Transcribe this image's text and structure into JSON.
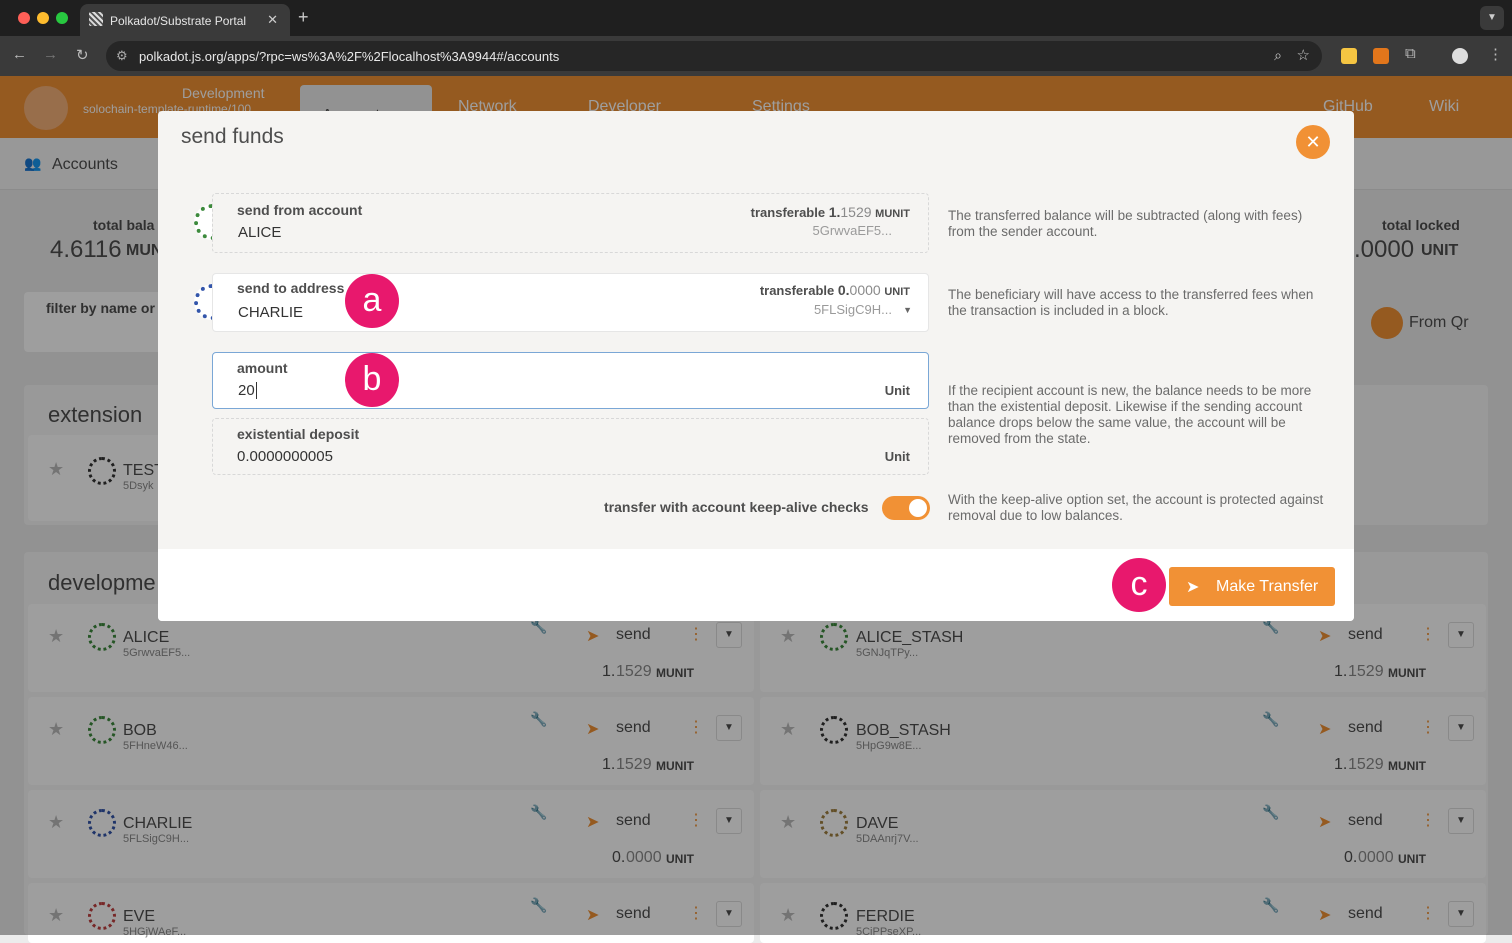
{
  "browser": {
    "tab_title": "Polkadot/Substrate Portal",
    "url": "polkadot.js.org/apps/?rpc=ws%3A%2F%2Flocalhost%3A9944#/accounts"
  },
  "app_header": {
    "chain": "Development",
    "runtime": "solochain-template-runtime/100",
    "nav": [
      "Accounts",
      "Network",
      "Developer",
      "Settings"
    ],
    "links": [
      "GitHub",
      "Wiki"
    ]
  },
  "subnav": {
    "accounts_label": "Accounts"
  },
  "summary": {
    "total_balance_label": "total bala",
    "total_balance_value": "4.6116",
    "total_balance_unit": "MUN",
    "total_locked_label": "total locked",
    "total_locked_value": ".0000",
    "total_locked_unit": "UNIT"
  },
  "filter": {
    "placeholder": "filter by name or"
  },
  "from_qr": "From Qr",
  "sections": {
    "extension": "extension",
    "development": "developme"
  },
  "extension_account": {
    "name": "TEST",
    "addr": "5Dsyk"
  },
  "accounts": [
    {
      "name": "ALICE",
      "addr": "5GrwvaEF5...",
      "bal_int": "1.",
      "bal_dec": "1529",
      "unit": "MUNIT",
      "send": "send"
    },
    {
      "name": "ALICE_STASH",
      "addr": "5GNJqTPy...",
      "bal_int": "1.",
      "bal_dec": "1529",
      "unit": "MUNIT",
      "send": "send"
    },
    {
      "name": "BOB",
      "addr": "5FHneW46...",
      "bal_int": "1.",
      "bal_dec": "1529",
      "unit": "MUNIT",
      "send": "send"
    },
    {
      "name": "BOB_STASH",
      "addr": "5HpG9w8E...",
      "bal_int": "1.",
      "bal_dec": "1529",
      "unit": "MUNIT",
      "send": "send"
    },
    {
      "name": "CHARLIE",
      "addr": "5FLSigC9H...",
      "bal_int": "0.",
      "bal_dec": "0000",
      "unit": "UNIT",
      "send": "send"
    },
    {
      "name": "DAVE",
      "addr": "5DAAnrj7V...",
      "bal_int": "0.",
      "bal_dec": "0000",
      "unit": "UNIT",
      "send": "send"
    },
    {
      "name": "EVE",
      "addr": "5HGjWAeF...",
      "send": "send"
    },
    {
      "name": "FERDIE",
      "addr": "5CiPPseXP...",
      "send": "send"
    }
  ],
  "modal": {
    "title": "send funds",
    "from": {
      "label": "send from account",
      "name": "ALICE",
      "transferable_label": "transferable",
      "transferable_int": "1.",
      "transferable_dec": "1529",
      "unit": "MUNIT",
      "addr": "5GrwvaEF5...",
      "help": "The transferred balance will be subtracted (along with fees) from the sender account."
    },
    "to": {
      "label": "send to address",
      "name": "CHARLIE",
      "transferable_label": "transferable",
      "transferable_int": "0.",
      "transferable_dec": "0000",
      "unit": "UNIT",
      "addr": "5FLSigC9H...",
      "help": "The beneficiary will have access to the transferred fees when the transaction is included in a block."
    },
    "amount": {
      "label": "amount",
      "value": "20",
      "unit": "Unit",
      "help": "If the recipient account is new, the balance needs to be more than the existential deposit. Likewise if the sending account balance drops below the same value, the account will be removed from the state."
    },
    "existential": {
      "label": "existential deposit",
      "value": "0.0000000005",
      "unit": "Unit"
    },
    "keepalive": {
      "label": "transfer with account keep-alive checks",
      "enabled": true,
      "help": "With the keep-alive option set, the account is protected against removal due to low balances."
    },
    "submit_label": "Make Transfer"
  },
  "annotations": {
    "a": "a",
    "b": "b",
    "c": "c"
  },
  "colors": {
    "accent": "#f19135",
    "badge": "#e8186d"
  }
}
